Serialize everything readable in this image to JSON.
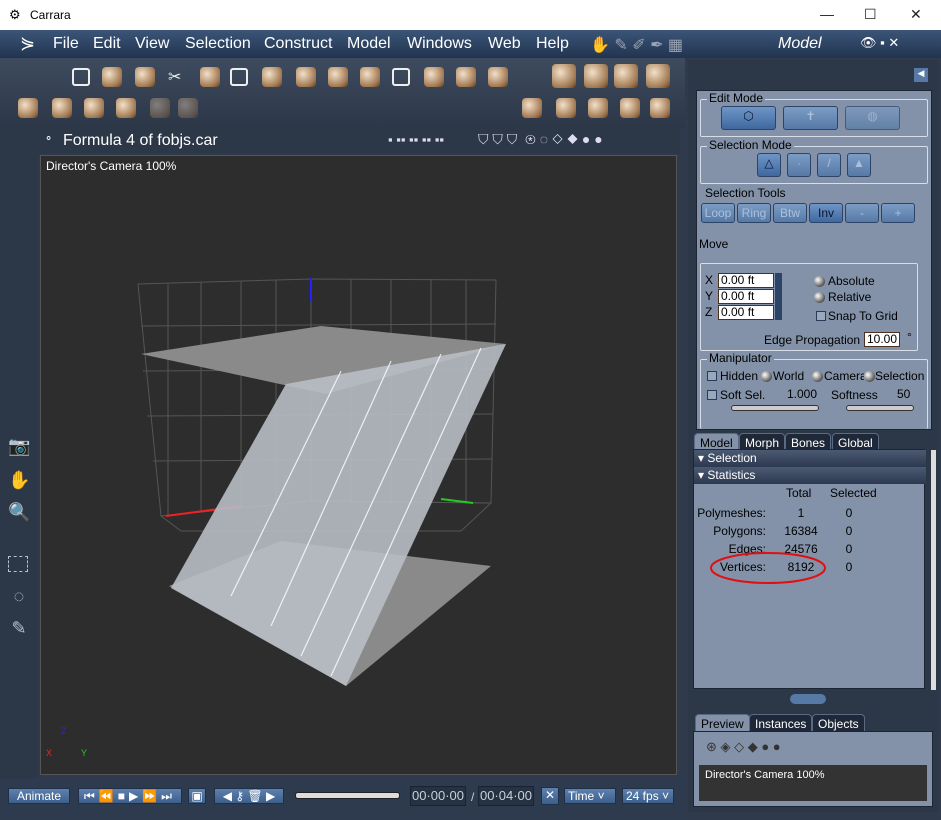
{
  "window": {
    "title": "Carrara",
    "controls": [
      "—",
      "☐",
      "✕"
    ]
  },
  "menu": {
    "items": [
      "File",
      "Edit",
      "View",
      "Selection",
      "Construct",
      "Model",
      "Windows",
      "Web",
      "Help"
    ],
    "room": "Model"
  },
  "viewport": {
    "doc_title": "Formula 4 of fobjs.car",
    "camera_label": "Director's Camera 100%",
    "axis": {
      "z": "Z",
      "x": "X",
      "y": "Y"
    }
  },
  "edit_mode": {
    "label": "Edit Mode"
  },
  "selection_mode": {
    "label": "Selection Mode"
  },
  "selection_tools": {
    "label": "Selection Tools",
    "buttons": [
      "Loop",
      "Ring",
      "Btw",
      "Inv",
      "-",
      "+"
    ]
  },
  "move": {
    "label": "Move",
    "x_label": "X",
    "y_label": "Y",
    "z_label": "Z",
    "x": "0.00 ft",
    "y": "0.00 ft",
    "z": "0.00 ft",
    "absolute": "Absolute",
    "relative": "Relative",
    "snap": "Snap To Grid",
    "edge_prop_label": "Edge Propagation",
    "edge_prop": "10.00",
    "degree": "°"
  },
  "manipulator": {
    "label": "Manipulator",
    "hidden": "Hidden",
    "world": "World",
    "camera": "Camera",
    "selection": "Selection",
    "soft_sel": "Soft Sel.",
    "soft_sel_value": "1.000",
    "softness": "Softness",
    "softness_value": "50"
  },
  "tabs": [
    "Model",
    "Morph",
    "Bones",
    "Global"
  ],
  "sections": {
    "selection": "Selection",
    "statistics": "Statistics"
  },
  "statistics": {
    "col_total": "Total",
    "col_selected": "Selected",
    "rows": [
      {
        "label": "Polymeshes:",
        "total": "1",
        "selected": "0"
      },
      {
        "label": "Polygons:",
        "total": "16384",
        "selected": "0"
      },
      {
        "label": "Edges:",
        "total": "24576",
        "selected": "0"
      },
      {
        "label": "Vertices:",
        "total": "8192",
        "selected": "0"
      }
    ]
  },
  "preview": {
    "tabs": [
      "Preview",
      "Instances",
      "Objects"
    ],
    "camera_label": "Director's Camera 100%"
  },
  "timeline": {
    "animate": "Animate",
    "current": "00·00·00",
    "sep": "/",
    "end": "00·04·00",
    "mode": "Time",
    "fps": "24 fps"
  },
  "colors": {
    "highlight_ellipse": "#e01010",
    "panel": "#8392a8",
    "menubar": "#2b3f5e"
  }
}
